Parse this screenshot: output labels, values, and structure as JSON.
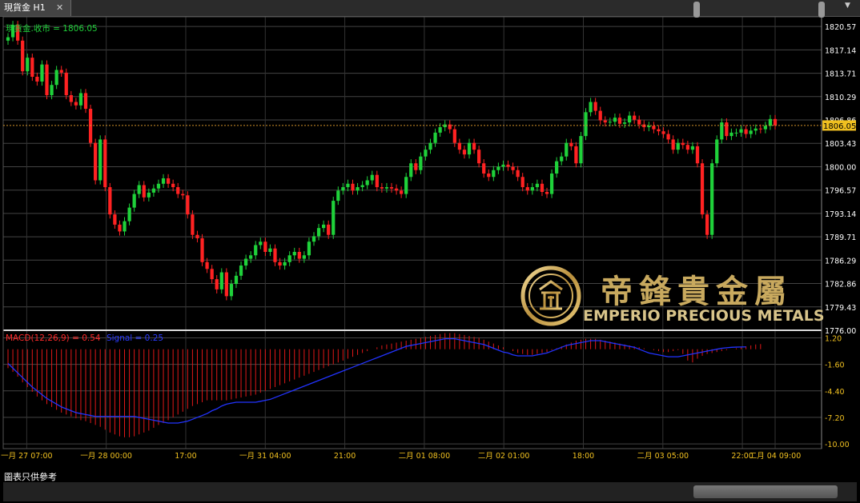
{
  "tab": {
    "title": "現貨金 H1",
    "close_glyph": "✕",
    "menu_glyph": "▼"
  },
  "price_panel": {
    "label": "現貨金.收市 = 1806.05",
    "current_price": "1806.05",
    "current_value": 1806.05
  },
  "macd_panel": {
    "label_macd": "MACD(12,26,9) = 0.54",
    "label_signal": "Signal = 0.25"
  },
  "footer": {
    "disclaimer": "圖表只供參考"
  },
  "logo": {
    "cn": "帝鋒貴金屬",
    "en": "EMPERIO PRECIOUS METALS"
  },
  "colors": {
    "up": "#1fd13a",
    "down": "#ff2222",
    "macd_hist": "#e01818",
    "signal": "#2233ff",
    "axis_text": "#ffffff",
    "time_text": "#f0c020",
    "grid": "#444444",
    "price_line": "#d4922a"
  },
  "chart_data": [
    {
      "type": "candlestick",
      "title": "現貨金.收市 = 1806.05",
      "ylim": [
        1776.0,
        1822.0
      ],
      "y_ticks": [
        "1820.57",
        "1817.14",
        "1813.71",
        "1810.29",
        "1806.86",
        "1803.43",
        "1800.00",
        "1796.57",
        "1793.14",
        "1789.71",
        "1786.29",
        "1782.86",
        "1779.43",
        "1776.00"
      ],
      "x_ticks": [
        "一月 27 07:00",
        "一月 28 00:00",
        "17:00",
        "一月 31 04:00",
        "21:00",
        "二月 01 08:00",
        "二月 02 01:00",
        "18:00",
        "二月 03 05:00",
        "22:00",
        "二月 04 09:00"
      ],
      "close": [
        1819.0,
        1820.8,
        1818.5,
        1814.0,
        1816.0,
        1813.2,
        1812.5,
        1815.0,
        1810.5,
        1812.0,
        1814.2,
        1813.8,
        1810.5,
        1809.5,
        1809.0,
        1810.8,
        1808.5,
        1803.5,
        1798.0,
        1804.0,
        1797.0,
        1793.0,
        1791.5,
        1790.5,
        1792.0,
        1794.0,
        1796.0,
        1797.3,
        1795.5,
        1796.2,
        1796.8,
        1797.5,
        1798.3,
        1797.5,
        1797.0,
        1796.0,
        1795.8,
        1793.0,
        1790.0,
        1789.5,
        1786.0,
        1785.0,
        1783.5,
        1782.0,
        1784.5,
        1781.0,
        1782.8,
        1784.0,
        1785.5,
        1786.5,
        1787.0,
        1788.5,
        1789.0,
        1787.5,
        1788.0,
        1786.0,
        1785.5,
        1786.0,
        1787.0,
        1787.5,
        1786.5,
        1787.0,
        1789.0,
        1789.8,
        1791.0,
        1791.5,
        1790.0,
        1795.0,
        1796.5,
        1797.0,
        1797.5,
        1796.5,
        1797.0,
        1797.3,
        1798.0,
        1798.8,
        1797.0,
        1796.8,
        1797.0,
        1796.8,
        1796.5,
        1796.0,
        1798.5,
        1800.5,
        1799.5,
        1801.5,
        1802.5,
        1803.5,
        1805.0,
        1805.8,
        1806.2,
        1805.5,
        1803.5,
        1802.5,
        1801.8,
        1803.5,
        1802.5,
        1800.5,
        1799.0,
        1798.5,
        1799.5,
        1800.0,
        1800.3,
        1800.0,
        1799.5,
        1798.5,
        1797.0,
        1796.5,
        1797.0,
        1797.5,
        1796.3,
        1796.0,
        1799.0,
        1800.8,
        1801.5,
        1803.5,
        1803.0,
        1800.5,
        1804.5,
        1808.0,
        1809.5,
        1808.2,
        1806.8,
        1806.5,
        1806.6,
        1807.2,
        1806.3,
        1806.5,
        1807.5,
        1806.9,
        1806.2,
        1805.8,
        1806.0,
        1805.5,
        1805.2,
        1804.8,
        1804.0,
        1802.5,
        1803.5,
        1803.2,
        1802.5,
        1803.0,
        1800.5,
        1793.0,
        1790.0,
        1800.5,
        1804.0,
        1806.5,
        1804.5,
        1805.0,
        1805.0,
        1805.5,
        1804.8,
        1805.3,
        1805.6,
        1805.5,
        1806.0,
        1807.0,
        1806.05
      ]
    },
    {
      "type": "bar+line",
      "title": "MACD(12,26,9) = 0.54",
      "ylim": [
        -10.5,
        2.0
      ],
      "y_ticks": [
        "1.20",
        "-1.60",
        "-4.40",
        "-7.20",
        "-10.00"
      ],
      "series": [
        {
          "name": "MACD(12,26,9)",
          "values": [
            -2.0,
            -2.4,
            -2.9,
            -3.5,
            -4.0,
            -4.5,
            -5.0,
            -5.4,
            -5.8,
            -6.1,
            -6.4,
            -6.7,
            -6.9,
            -7.1,
            -7.3,
            -7.5,
            -7.6,
            -7.8,
            -8.0,
            -8.2,
            -8.5,
            -8.8,
            -9.0,
            -9.2,
            -9.3,
            -9.3,
            -9.2,
            -9.0,
            -8.8,
            -8.6,
            -8.3,
            -8.0,
            -7.8,
            -7.5,
            -7.2,
            -6.9,
            -6.6,
            -6.3,
            -6.0,
            -5.8,
            -5.6,
            -5.4,
            -5.4,
            -5.4,
            -5.4,
            -5.4,
            -5.3,
            -5.2,
            -5.1,
            -5.0,
            -4.9,
            -4.8,
            -4.6,
            -4.4,
            -4.2,
            -4.0,
            -3.8,
            -3.6,
            -3.4,
            -3.2,
            -3.0,
            -2.8,
            -2.6,
            -2.4,
            -2.2,
            -2.0,
            -1.8,
            -1.6,
            -1.4,
            -1.2,
            -1.0,
            -0.8,
            -0.6,
            -0.4,
            -0.2,
            0.0,
            0.2,
            0.4,
            0.5,
            0.6,
            0.7,
            0.8,
            0.9,
            1.0,
            1.1,
            1.2,
            1.3,
            1.4,
            1.5,
            1.6,
            1.7,
            1.7,
            1.7,
            1.6,
            1.5,
            1.4,
            1.3,
            1.2,
            1.0,
            0.8,
            0.6,
            0.4,
            0.2,
            0.0,
            -0.2,
            -0.4,
            -0.5,
            -0.6,
            -0.6,
            -0.5,
            -0.4,
            -0.3,
            -0.1,
            0.1,
            0.3,
            0.5,
            0.7,
            0.9,
            1.0,
            1.1,
            1.1,
            1.1,
            1.0,
            0.9,
            0.8,
            0.7,
            0.6,
            0.5,
            0.4,
            0.3,
            0.2,
            0.1,
            0.0,
            -0.1,
            -0.2,
            -0.3,
            -0.3,
            -0.2,
            -0.1,
            -0.5,
            -1.2,
            -1.4,
            -1.0,
            -0.7,
            -0.5,
            -0.4,
            -0.3,
            -0.2,
            -0.1,
            0.0,
            0.1,
            0.2,
            0.3,
            0.4,
            0.5,
            0.54
          ]
        },
        {
          "name": "Signal",
          "values": [
            -1.5,
            -2.0,
            -2.5,
            -3.0,
            -3.5,
            -4.0,
            -4.4,
            -4.8,
            -5.2,
            -5.5,
            -5.8,
            -6.1,
            -6.3,
            -6.5,
            -6.7,
            -6.8,
            -6.9,
            -7.0,
            -7.1,
            -7.1,
            -7.1,
            -7.1,
            -7.1,
            -7.1,
            -7.1,
            -7.1,
            -7.1,
            -7.2,
            -7.3,
            -7.4,
            -7.5,
            -7.6,
            -7.7,
            -7.8,
            -7.8,
            -7.8,
            -7.7,
            -7.6,
            -7.4,
            -7.2,
            -7.0,
            -6.8,
            -6.5,
            -6.3,
            -6.0,
            -5.8,
            -5.7,
            -5.6,
            -5.6,
            -5.6,
            -5.6,
            -5.6,
            -5.5,
            -5.4,
            -5.3,
            -5.1,
            -4.9,
            -4.7,
            -4.5,
            -4.3,
            -4.1,
            -3.9,
            -3.7,
            -3.5,
            -3.3,
            -3.1,
            -2.9,
            -2.7,
            -2.5,
            -2.3,
            -2.1,
            -1.9,
            -1.7,
            -1.5,
            -1.3,
            -1.1,
            -0.9,
            -0.7,
            -0.5,
            -0.3,
            -0.1,
            0.1,
            0.3,
            0.4,
            0.5,
            0.6,
            0.7,
            0.8,
            0.9,
            1.0,
            1.1,
            1.1,
            1.1,
            1.0,
            0.9,
            0.8,
            0.7,
            0.6,
            0.5,
            0.3,
            0.1,
            -0.1,
            -0.3,
            -0.4,
            -0.6,
            -0.7,
            -0.7,
            -0.7,
            -0.7,
            -0.6,
            -0.5,
            -0.4,
            -0.2,
            0.0,
            0.2,
            0.4,
            0.5,
            0.6,
            0.7,
            0.8,
            0.9,
            0.9,
            0.9,
            0.8,
            0.7,
            0.6,
            0.5,
            0.4,
            0.3,
            0.2,
            0.0,
            -0.2,
            -0.4,
            -0.5,
            -0.6,
            -0.7,
            -0.8,
            -0.8,
            -0.8,
            -0.7,
            -0.6,
            -0.5,
            -0.4,
            -0.3,
            -0.2,
            -0.1,
            0.0,
            0.1,
            0.15,
            0.2,
            0.22,
            0.24,
            0.25
          ]
        }
      ]
    }
  ]
}
